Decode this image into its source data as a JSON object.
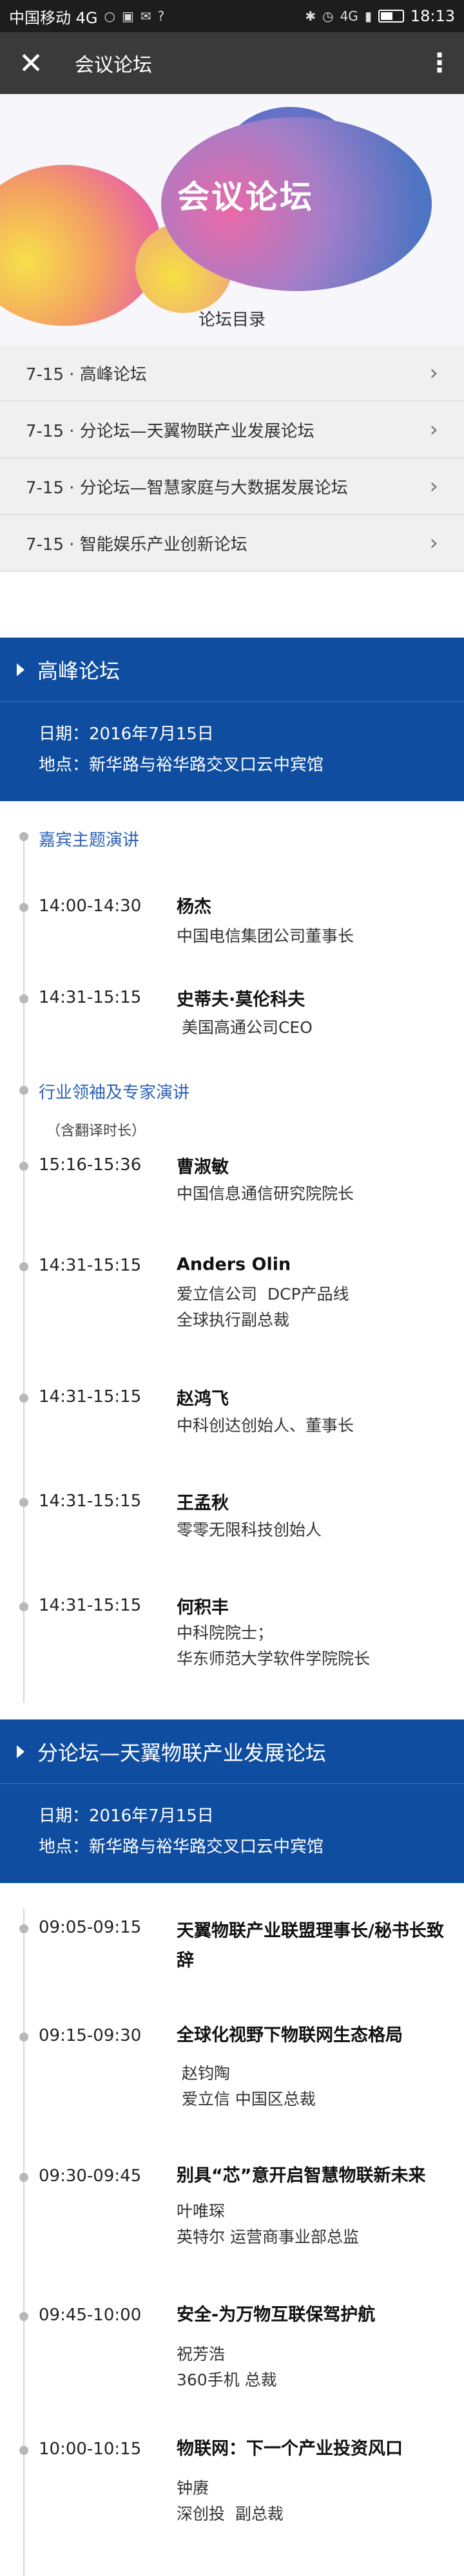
{
  "statusbar": {
    "carrier": "中国移动 4G",
    "network": "4G",
    "time": "18:13"
  },
  "navbar": {
    "close_icon": "close-icon",
    "title": "会议论坛",
    "more_icon": "more-vertical-icon"
  },
  "banner": {
    "title": "会议论坛",
    "subtitle": "论坛目录",
    "colors": [
      "#f7e14a",
      "#e9679f",
      "#4f74c2"
    ]
  },
  "directory": [
    {
      "label": "7-15 · 高峰论坛"
    },
    {
      "label": "7-15 · 分论坛—天翼物联产业发展论坛"
    },
    {
      "label": "7-15 · 分论坛—智慧家庭与大数据发展论坛"
    },
    {
      "label": "7-15 · 智能娱乐产业创新论坛"
    }
  ],
  "sections": [
    {
      "title": "高峰论坛",
      "date": "日期：2016年7月15日",
      "location": "地点：新华路与裕华路交叉口云中宾馆",
      "categories": [
        {
          "label": "嘉宾主题演讲"
        },
        {
          "label": "行业领袖及专家演讲",
          "note": "（含翻译时长）"
        }
      ],
      "talks": [
        {
          "time": "14:00-14:30",
          "name": "杨杰",
          "desc": [
            "中国电信集团公司董事长"
          ]
        },
        {
          "time": "14:31-15:15",
          "name": "史蒂夫·莫伦科夫",
          "desc": [
            " 美国高通公司CEO"
          ]
        },
        {
          "time": "15:16-15:36",
          "name": "曹淑敏",
          "desc": [
            "中国信息通信研究院院长"
          ]
        },
        {
          "time": "14:31-15:15",
          "name": "Anders  Olin",
          "desc": [
            "爱立信公司  DCP产品线",
            "全球执行副总裁"
          ]
        },
        {
          "time": "14:31-15:15",
          "name": "赵鸿飞",
          "desc": [
            "中科创达创始人、董事长"
          ]
        },
        {
          "time": "14:31-15:15",
          "name": "王孟秋",
          "desc": [
            "零零无限科技创始人"
          ]
        },
        {
          "time": "14:31-15:15",
          "name": "何积丰",
          "desc": [
            "中科院院士；",
            "华东师范大学软件学院院长"
          ]
        }
      ]
    },
    {
      "title": "分论坛—天翼物联产业发展论坛",
      "date": "日期：2016年7月15日",
      "location": "地点：新华路与裕华路交叉口云中宾馆",
      "talks": [
        {
          "time": "09:05-09:15",
          "topic": "天翼物联产业联盟理事长/秘书长致辞",
          "desc": []
        },
        {
          "time": "09:15-09:30",
          "topic": "全球化视野下物联网生态格局",
          "desc": [
            " 赵钧陶",
            " 爱立信 中国区总裁"
          ]
        },
        {
          "time": "09:30-09:45",
          "topic": "别具“芯”意开启智慧物联新未来",
          "desc": [
            "叶唯琛",
            "英特尔 运营商事业部总监"
          ]
        },
        {
          "time": "09:45-10:00",
          "topic": "安全-为万物互联保驾护航",
          "desc": [
            "祝芳浩",
            "360手机 总裁"
          ]
        },
        {
          "time": "10:00-10:15",
          "topic": "物联网：下一个产业投资风口",
          "desc": [
            "钟赓",
            "深创投  副总裁"
          ]
        }
      ]
    }
  ]
}
